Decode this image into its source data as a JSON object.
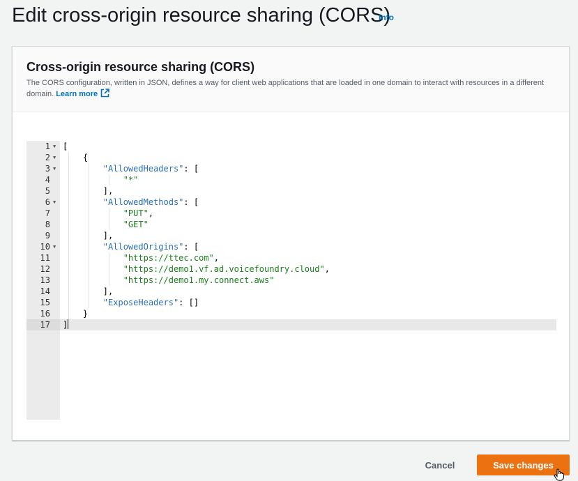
{
  "header": {
    "title": "Edit cross-origin resource sharing (CORS)",
    "info_link": "Info"
  },
  "panel": {
    "title": "Cross-origin resource sharing (CORS)",
    "description": "The CORS configuration, written in JSON, defines a way for client web applications that are loaded in one domain to interact with resources in a different domain.",
    "learn_more": "Learn more",
    "learn_more_icon": "external-link-icon"
  },
  "editor": {
    "active_line": 17,
    "lines": [
      {
        "num": "1",
        "fold": true,
        "parts": [
          {
            "t": "p",
            "v": "["
          }
        ]
      },
      {
        "num": "2",
        "fold": true,
        "parts": [
          {
            "t": "p",
            "v": "    {"
          }
        ]
      },
      {
        "num": "3",
        "fold": true,
        "parts": [
          {
            "t": "p",
            "v": "        "
          },
          {
            "t": "k",
            "v": "\"AllowedHeaders\""
          },
          {
            "t": "p",
            "v": ": ["
          }
        ]
      },
      {
        "num": "4",
        "fold": false,
        "parts": [
          {
            "t": "p",
            "v": "            "
          },
          {
            "t": "s",
            "v": "\"*\""
          }
        ]
      },
      {
        "num": "5",
        "fold": false,
        "parts": [
          {
            "t": "p",
            "v": "        ],"
          }
        ]
      },
      {
        "num": "6",
        "fold": true,
        "parts": [
          {
            "t": "p",
            "v": "        "
          },
          {
            "t": "k",
            "v": "\"AllowedMethods\""
          },
          {
            "t": "p",
            "v": ": ["
          }
        ]
      },
      {
        "num": "7",
        "fold": false,
        "parts": [
          {
            "t": "p",
            "v": "            "
          },
          {
            "t": "s",
            "v": "\"PUT\""
          },
          {
            "t": "p",
            "v": ","
          }
        ]
      },
      {
        "num": "8",
        "fold": false,
        "parts": [
          {
            "t": "p",
            "v": "            "
          },
          {
            "t": "s",
            "v": "\"GET\""
          }
        ]
      },
      {
        "num": "9",
        "fold": false,
        "parts": [
          {
            "t": "p",
            "v": "        ],"
          }
        ]
      },
      {
        "num": "10",
        "fold": true,
        "parts": [
          {
            "t": "p",
            "v": "        "
          },
          {
            "t": "k",
            "v": "\"AllowedOrigins\""
          },
          {
            "t": "p",
            "v": ": ["
          }
        ]
      },
      {
        "num": "11",
        "fold": false,
        "parts": [
          {
            "t": "p",
            "v": "            "
          },
          {
            "t": "s",
            "v": "\"https://ttec.com\""
          },
          {
            "t": "p",
            "v": ","
          }
        ]
      },
      {
        "num": "12",
        "fold": false,
        "parts": [
          {
            "t": "p",
            "v": "            "
          },
          {
            "t": "s",
            "v": "\"https://demo1.vf.ad.voicefoundry.cloud\""
          },
          {
            "t": "p",
            "v": ","
          }
        ]
      },
      {
        "num": "13",
        "fold": false,
        "parts": [
          {
            "t": "p",
            "v": "            "
          },
          {
            "t": "s",
            "v": "\"https://demo1.my.connect.aws\""
          }
        ]
      },
      {
        "num": "14",
        "fold": false,
        "parts": [
          {
            "t": "p",
            "v": "        ],"
          }
        ]
      },
      {
        "num": "15",
        "fold": false,
        "parts": [
          {
            "t": "p",
            "v": "        "
          },
          {
            "t": "k",
            "v": "\"ExposeHeaders\""
          },
          {
            "t": "p",
            "v": ": []"
          }
        ]
      },
      {
        "num": "16",
        "fold": false,
        "parts": [
          {
            "t": "p",
            "v": "    }"
          }
        ]
      },
      {
        "num": "17",
        "fold": false,
        "parts": [
          {
            "t": "p",
            "v": "]"
          }
        ]
      }
    ]
  },
  "footer": {
    "cancel_label": "Cancel",
    "save_label": "Save changes"
  },
  "colors": {
    "primary_button": "#ec7211",
    "link": "#0073bb",
    "json_key": "#2b6fb4",
    "json_string": "#1a7f1a"
  }
}
